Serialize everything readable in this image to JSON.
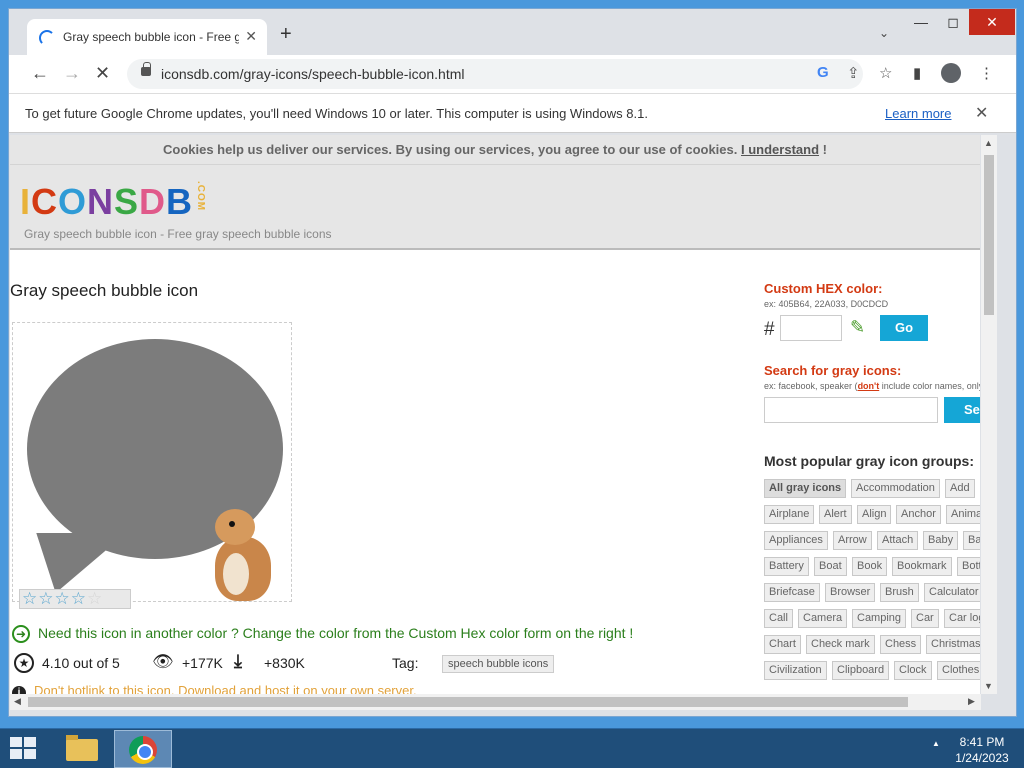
{
  "browser": {
    "tab_title": "Gray speech bubble icon - Free g",
    "url": "iconsdb.com/gray-icons/speech-bubble-icon.html",
    "infobar_message": "To get future Google Chrome updates, you'll need Windows 10 or later. This computer is using Windows 8.1.",
    "infobar_link": "Learn more"
  },
  "page": {
    "cookie_text": "Cookies help us deliver our services. By using our services, you agree to our use of cookies.",
    "cookie_link": "I understand",
    "cookie_bang": "!",
    "logo_text": "ICONSDB",
    "logo_dotcom": ".COM",
    "subtitle": "Gray speech bubble icon - Free gray speech bubble icons",
    "title": "Gray speech bubble icon",
    "rating_value": 4.1,
    "notice": "Need this icon in another color ? Change the color from the Custom Hex color form on the right !",
    "rating_text": "4.10 out of 5",
    "views": "+177K",
    "downloads": "+830K",
    "tag_label": "Tag:",
    "tag": "speech bubble icons",
    "hotlink_warning": "Don't hotlink to this icon. Download and host it on your own server."
  },
  "sidebar": {
    "custom_hex_label": "Custom HEX color:",
    "custom_hex_example": "ex: 405B64, 22A033, D0CDCD",
    "hash": "#",
    "go_button": "Go",
    "search_label": "Search for gray icons:",
    "search_hint_prefix": "ex: facebook, speaker (",
    "search_hint_dont": "don't",
    "search_hint_suffix": " include color names, only",
    "search_button": "Se",
    "groups_title": "Most popular gray icon groups:",
    "chips": [
      [
        "All gray icons",
        "Accommodation",
        "Add",
        ""
      ],
      [
        "Airplane",
        "Alert",
        "Align",
        "Anchor",
        "Animal"
      ],
      [
        "Appliances",
        "Arrow",
        "Attach",
        "Baby",
        "Badg"
      ],
      [
        "Battery",
        "Boat",
        "Book",
        "Bookmark",
        "Bottle"
      ],
      [
        "Briefcase",
        "Browser",
        "Brush",
        "Calculator",
        ""
      ],
      [
        "Call",
        "Camera",
        "Camping",
        "Car",
        "Car logo"
      ],
      [
        "Chart",
        "Check mark",
        "Chess",
        "Christmas"
      ],
      [
        "Civilization",
        "Clipboard",
        "Clock",
        "Clothes",
        ""
      ]
    ]
  },
  "taskbar": {
    "time": "8:41 PM",
    "date": "1/24/2023"
  },
  "colors": {
    "accent_red": "#d33a13",
    "button_blue": "#15a6d6",
    "notice_green": "#2b7f1c",
    "warning_orange": "#e2a23a",
    "icon_gray": "#7c7c7c"
  }
}
